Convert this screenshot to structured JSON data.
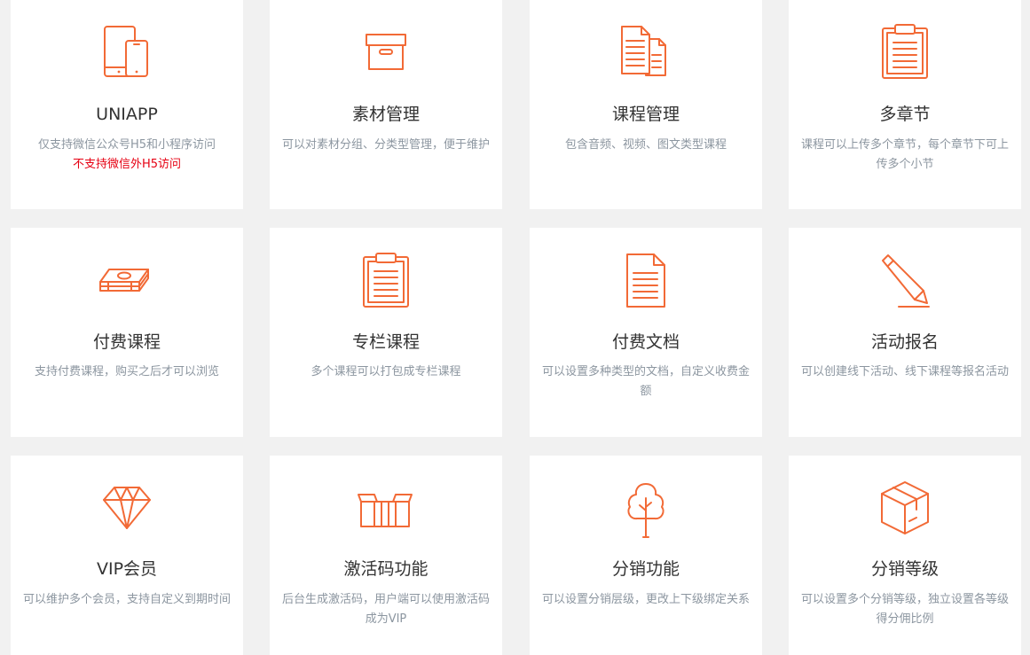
{
  "theme": {
    "icon_color": "#f26a36",
    "warning_color": "#e60012"
  },
  "features": [
    {
      "icon": "devices-icon",
      "title": "UNIAPP",
      "desc": "仅支持微信公众号H5和小程序访问",
      "note": "不支持微信外H5访问"
    },
    {
      "icon": "archive-box-icon",
      "title": "素材管理",
      "desc": "可以对素材分组、分类型管理，便于维护"
    },
    {
      "icon": "documents-icon",
      "title": "课程管理",
      "desc": "包含音频、视频、图文类型课程"
    },
    {
      "icon": "clipboard-icon",
      "title": "多章节",
      "desc": "课程可以上传多个章节，每个章节下可上传多个小节"
    },
    {
      "icon": "money-stack-icon",
      "title": "付费课程",
      "desc": "支持付费课程，购买之后才可以浏览"
    },
    {
      "icon": "clipboard-list-icon",
      "title": "专栏课程",
      "desc": "多个课程可以打包成专栏课程"
    },
    {
      "icon": "document-icon",
      "title": "付费文档",
      "desc": "可以设置多种类型的文档，自定义收费金额"
    },
    {
      "icon": "pencil-icon",
      "title": "活动报名",
      "desc": "可以创建线下活动、线下课程等报名活动"
    },
    {
      "icon": "diamond-icon",
      "title": "VIP会员",
      "desc": "可以维护多个会员，支持自定义到期时间"
    },
    {
      "icon": "open-box-icon",
      "title": "激活码功能",
      "desc": "后台生成激活码，用户端可以使用激活码成为VIP"
    },
    {
      "icon": "tree-icon",
      "title": "分销功能",
      "desc": "可以设置分销层级，更改上下级绑定关系"
    },
    {
      "icon": "cube-box-icon",
      "title": "分销等级",
      "desc": "可以设置多个分销等级，独立设置各等级得分佣比例"
    }
  ]
}
